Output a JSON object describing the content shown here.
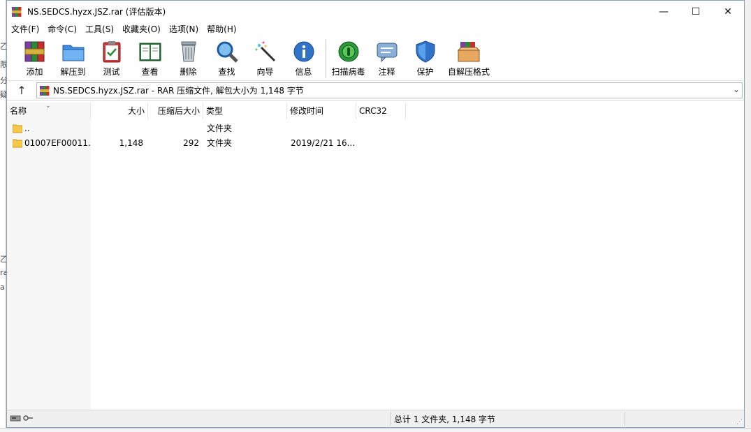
{
  "background": {
    "left_fragments": [
      "乙",
      "限",
      "分",
      "疑",
      "乙",
      "ra",
      "a"
    ]
  },
  "window": {
    "title": "NS.SEDCS.hyzx.JSZ.rar (评估版本)",
    "controls": {
      "minimize": "—",
      "maximize": "☐",
      "close": "✕"
    }
  },
  "menu": [
    "文件(F)",
    "命令(C)",
    "工具(S)",
    "收藏夹(O)",
    "选项(N)",
    "帮助(H)"
  ],
  "toolbar": [
    {
      "label": "添加",
      "icon": "add-archive-icon"
    },
    {
      "label": "解压到",
      "icon": "extract-folder-icon"
    },
    {
      "label": "测试",
      "icon": "test-clipboard-icon"
    },
    {
      "label": "查看",
      "icon": "view-book-icon"
    },
    {
      "label": "删除",
      "icon": "delete-trash-icon"
    },
    {
      "label": "查找",
      "icon": "find-magnifier-icon"
    },
    {
      "label": "向导",
      "icon": "wizard-wand-icon"
    },
    {
      "label": "信息",
      "icon": "info-icon"
    },
    {
      "label": "扫描病毒",
      "icon": "virus-scan-icon"
    },
    {
      "label": "注释",
      "icon": "comment-icon"
    },
    {
      "label": "保护",
      "icon": "protect-shield-icon"
    },
    {
      "label": "自解压格式",
      "icon": "sfx-box-icon"
    }
  ],
  "address": {
    "up": "↑",
    "path": "NS.SEDCS.hyzx.JSZ.rar - RAR 压缩文件, 解包大小为 1,148 字节"
  },
  "columns": {
    "name": "名称",
    "size": "大小",
    "packed": "压缩后大小",
    "type": "类型",
    "modified": "修改时间",
    "crc": "CRC32"
  },
  "rows": [
    {
      "name": "..",
      "size": "",
      "packed": "",
      "type": "文件夹",
      "modified": "",
      "crc": ""
    },
    {
      "name": "01007EF00011...",
      "size": "1,148",
      "packed": "292",
      "type": "文件夹",
      "modified": "2019/2/21 16...",
      "crc": ""
    }
  ],
  "status": {
    "summary": "总计 1 文件夹, 1,148 字节"
  },
  "colors": {
    "window_border": "#8aa0c0",
    "folder": "#f5c84c",
    "accent_blue": "#1e6fd0"
  }
}
